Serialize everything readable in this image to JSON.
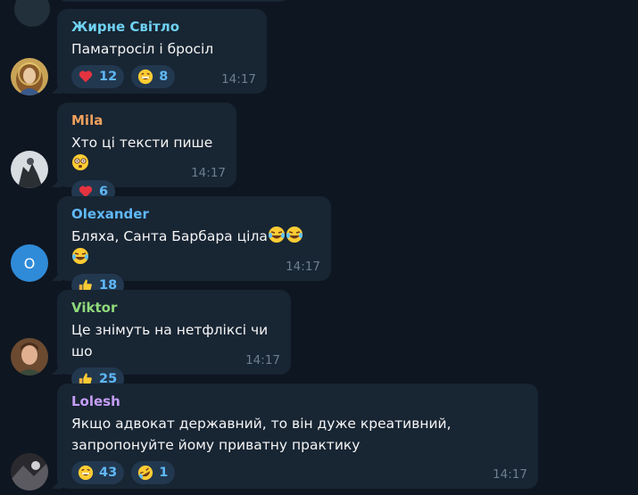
{
  "colors": {
    "background": "#0e1621",
    "bubble": "#182533",
    "reaction_bg": "#22384f",
    "reaction_text": "#5fb8f6",
    "time": "#6d7f8f"
  },
  "messages": [
    {
      "author": "Жирне Світло",
      "author_color": "#6fd2f2",
      "avatar": "portrait-icon",
      "text": "Паматросіл і бросіл",
      "text_emojis": [],
      "time": "14:17",
      "reactions": [
        {
          "emoji": "heart-icon",
          "count": "12"
        },
        {
          "emoji": "grinning-face-icon",
          "count": "8"
        }
      ]
    },
    {
      "author": "Mila",
      "author_color": "#f0a05c",
      "avatar": "grey-photo-icon",
      "text": "Хто ці тексти пише ",
      "text_emojis": [
        "dizzy-face-icon"
      ],
      "time": "14:17",
      "reactions": [
        {
          "emoji": "heart-icon",
          "count": "6"
        }
      ]
    },
    {
      "author": "Olexander",
      "author_color": "#5fb8f6",
      "avatar_letter": "O",
      "text": "Бляха, Санта Барбара ціла",
      "text_emojis": [
        "tears-of-joy-icon",
        "tears-of-joy-icon",
        "tears-of-joy-icon"
      ],
      "time": "14:17",
      "reactions": [
        {
          "emoji": "thumbs-up-icon",
          "count": "18"
        }
      ]
    },
    {
      "author": "Viktor",
      "author_color": "#8fd97a",
      "avatar": "man-photo-icon",
      "text": "Це знімуть на нетфліксі чи шо",
      "text_emojis": [],
      "time": "14:17",
      "reactions": [
        {
          "emoji": "thumbs-up-icon",
          "count": "25"
        }
      ]
    },
    {
      "author": "Lolesh",
      "author_color": "#c59ef5",
      "avatar": "dark-photo-icon",
      "text": "Якщо адвокат державний, то він дуже креативний, запропонуйте йому приватну практику",
      "text_emojis": [],
      "time": "14:17",
      "reactions": [
        {
          "emoji": "grinning-face-icon",
          "count": "43"
        },
        {
          "emoji": "rofl-icon",
          "count": "1"
        }
      ]
    }
  ]
}
